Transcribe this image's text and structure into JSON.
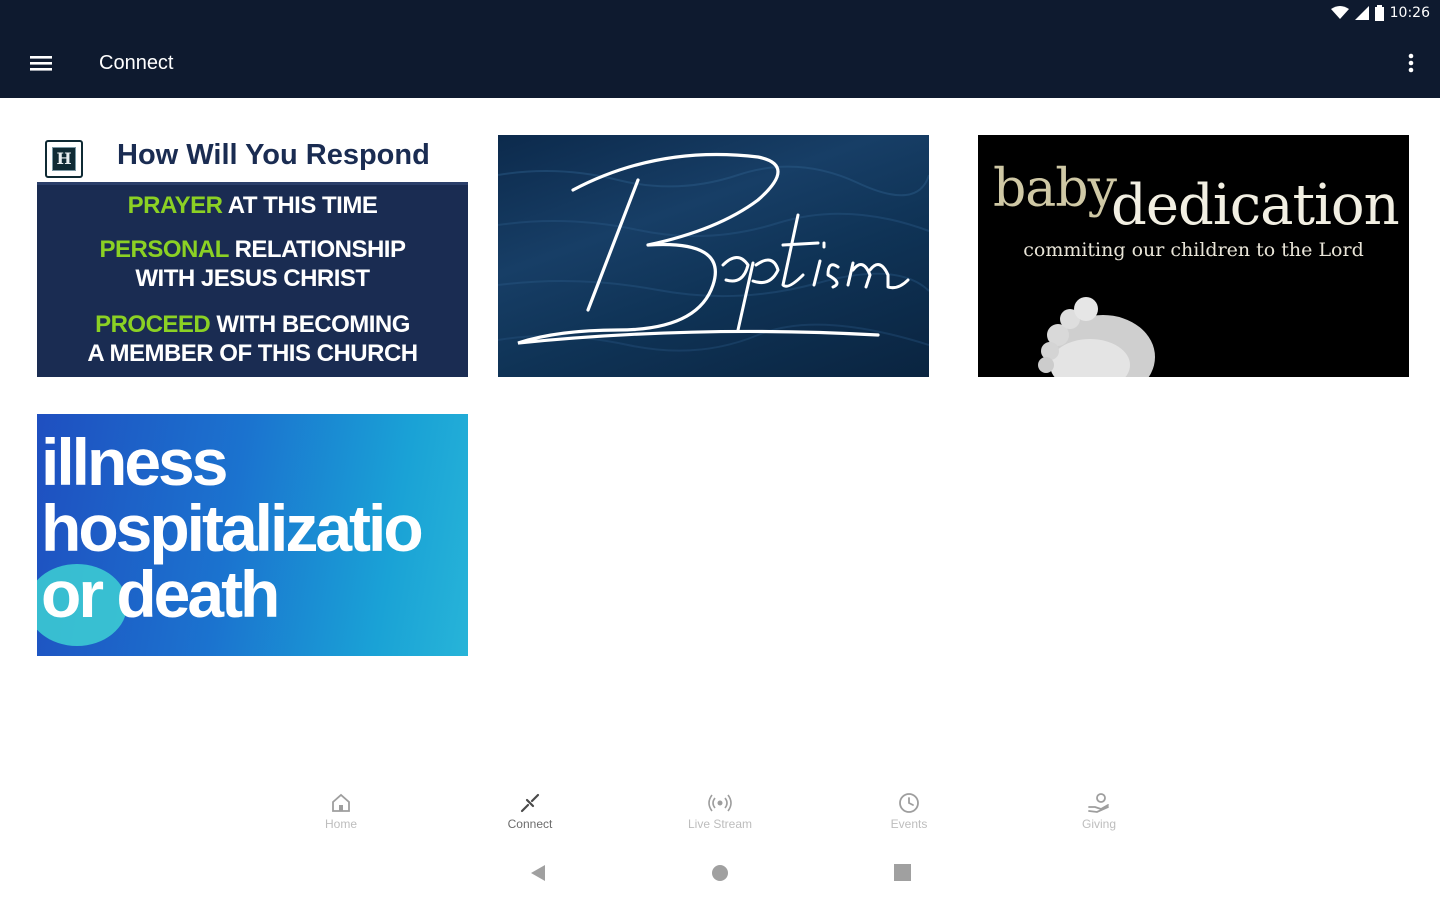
{
  "status_bar": {
    "time": "10:26",
    "icons": [
      "wifi-icon",
      "signal-icon",
      "battery-icon"
    ]
  },
  "app_bar": {
    "title": "Connect",
    "icons": [
      "menu-icon",
      "more-vert-icon"
    ]
  },
  "cards": [
    {
      "id": "how-will-you-respond",
      "logo_letter": "H",
      "heading": "How Will You Respond",
      "lines": [
        {
          "highlight": "PRAYER",
          "rest": " AT THIS TIME"
        },
        {
          "highlight": "PERSONAL",
          "rest": " RELATIONSHIP"
        },
        {
          "highlight": "",
          "rest": "WITH JESUS CHRIST"
        },
        {
          "highlight": "PROCEED",
          "rest": " WITH BECOMING"
        },
        {
          "highlight": "",
          "rest": "A MEMBER OF THIS CHURCH"
        }
      ]
    },
    {
      "id": "baptism",
      "title": "Baptism"
    },
    {
      "id": "baby-dedication",
      "title_a": "baby",
      "title_b": "dedication",
      "subtitle": "commiting our children to the Lord"
    },
    {
      "id": "illness",
      "lines": [
        "illness",
        "hospitalizatio",
        "or death"
      ]
    }
  ],
  "bottom_nav": [
    {
      "label": "Home",
      "icon": "home-icon",
      "active": false
    },
    {
      "label": "Connect",
      "icon": "connect-icon",
      "active": true
    },
    {
      "label": "Live Stream",
      "icon": "live-stream-icon",
      "active": false
    },
    {
      "label": "Events",
      "icon": "clock-icon",
      "active": false
    },
    {
      "label": "Giving",
      "icon": "giving-icon",
      "active": false
    }
  ],
  "colors": {
    "app_bar": "#0e1a2f",
    "highlight_green": "#8bd124",
    "card_navy": "#1a2c52"
  }
}
